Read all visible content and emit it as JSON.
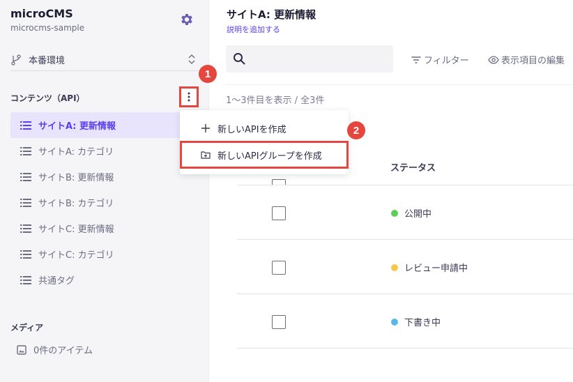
{
  "sidebar": {
    "brand_name": "microCMS",
    "brand_sub": "microcms-sample",
    "environment": "本番環境",
    "contents_title": "コンテンツ（API）",
    "apis": [
      {
        "label": "サイトA: 更新情報",
        "active": true
      },
      {
        "label": "サイトA: カテゴリ",
        "active": false
      },
      {
        "label": "サイトB: 更新情報",
        "active": false
      },
      {
        "label": "サイトB: カテゴリ",
        "active": false
      },
      {
        "label": "サイトC: 更新情報",
        "active": false
      },
      {
        "label": "サイトC: カテゴリ",
        "active": false
      },
      {
        "label": "共通タグ",
        "active": false
      }
    ],
    "media_title": "メディア",
    "media_item": "0件のアイテム"
  },
  "menu": {
    "new_api": "新しいAPIを作成",
    "new_api_group": "新しいAPIグループを作成"
  },
  "badges": {
    "one": "1",
    "two": "2"
  },
  "main": {
    "title": "サイトA: 更新情報",
    "description": "説明を追加する",
    "search_value": "",
    "filter_label": "フィルター",
    "display_label": "表示項目の編集",
    "count_text": "1〜3件目を表示 / 全3件",
    "status_header": "ステータス",
    "rows": [
      {
        "status": "公開中",
        "color": "#5ccf56"
      },
      {
        "status": "レビュー申請中",
        "color": "#f5c84c"
      },
      {
        "status": "下書き中",
        "color": "#5ab7ee"
      }
    ]
  },
  "colors": {
    "accent": "#5a3ff0",
    "annotation": "#e5473f"
  }
}
